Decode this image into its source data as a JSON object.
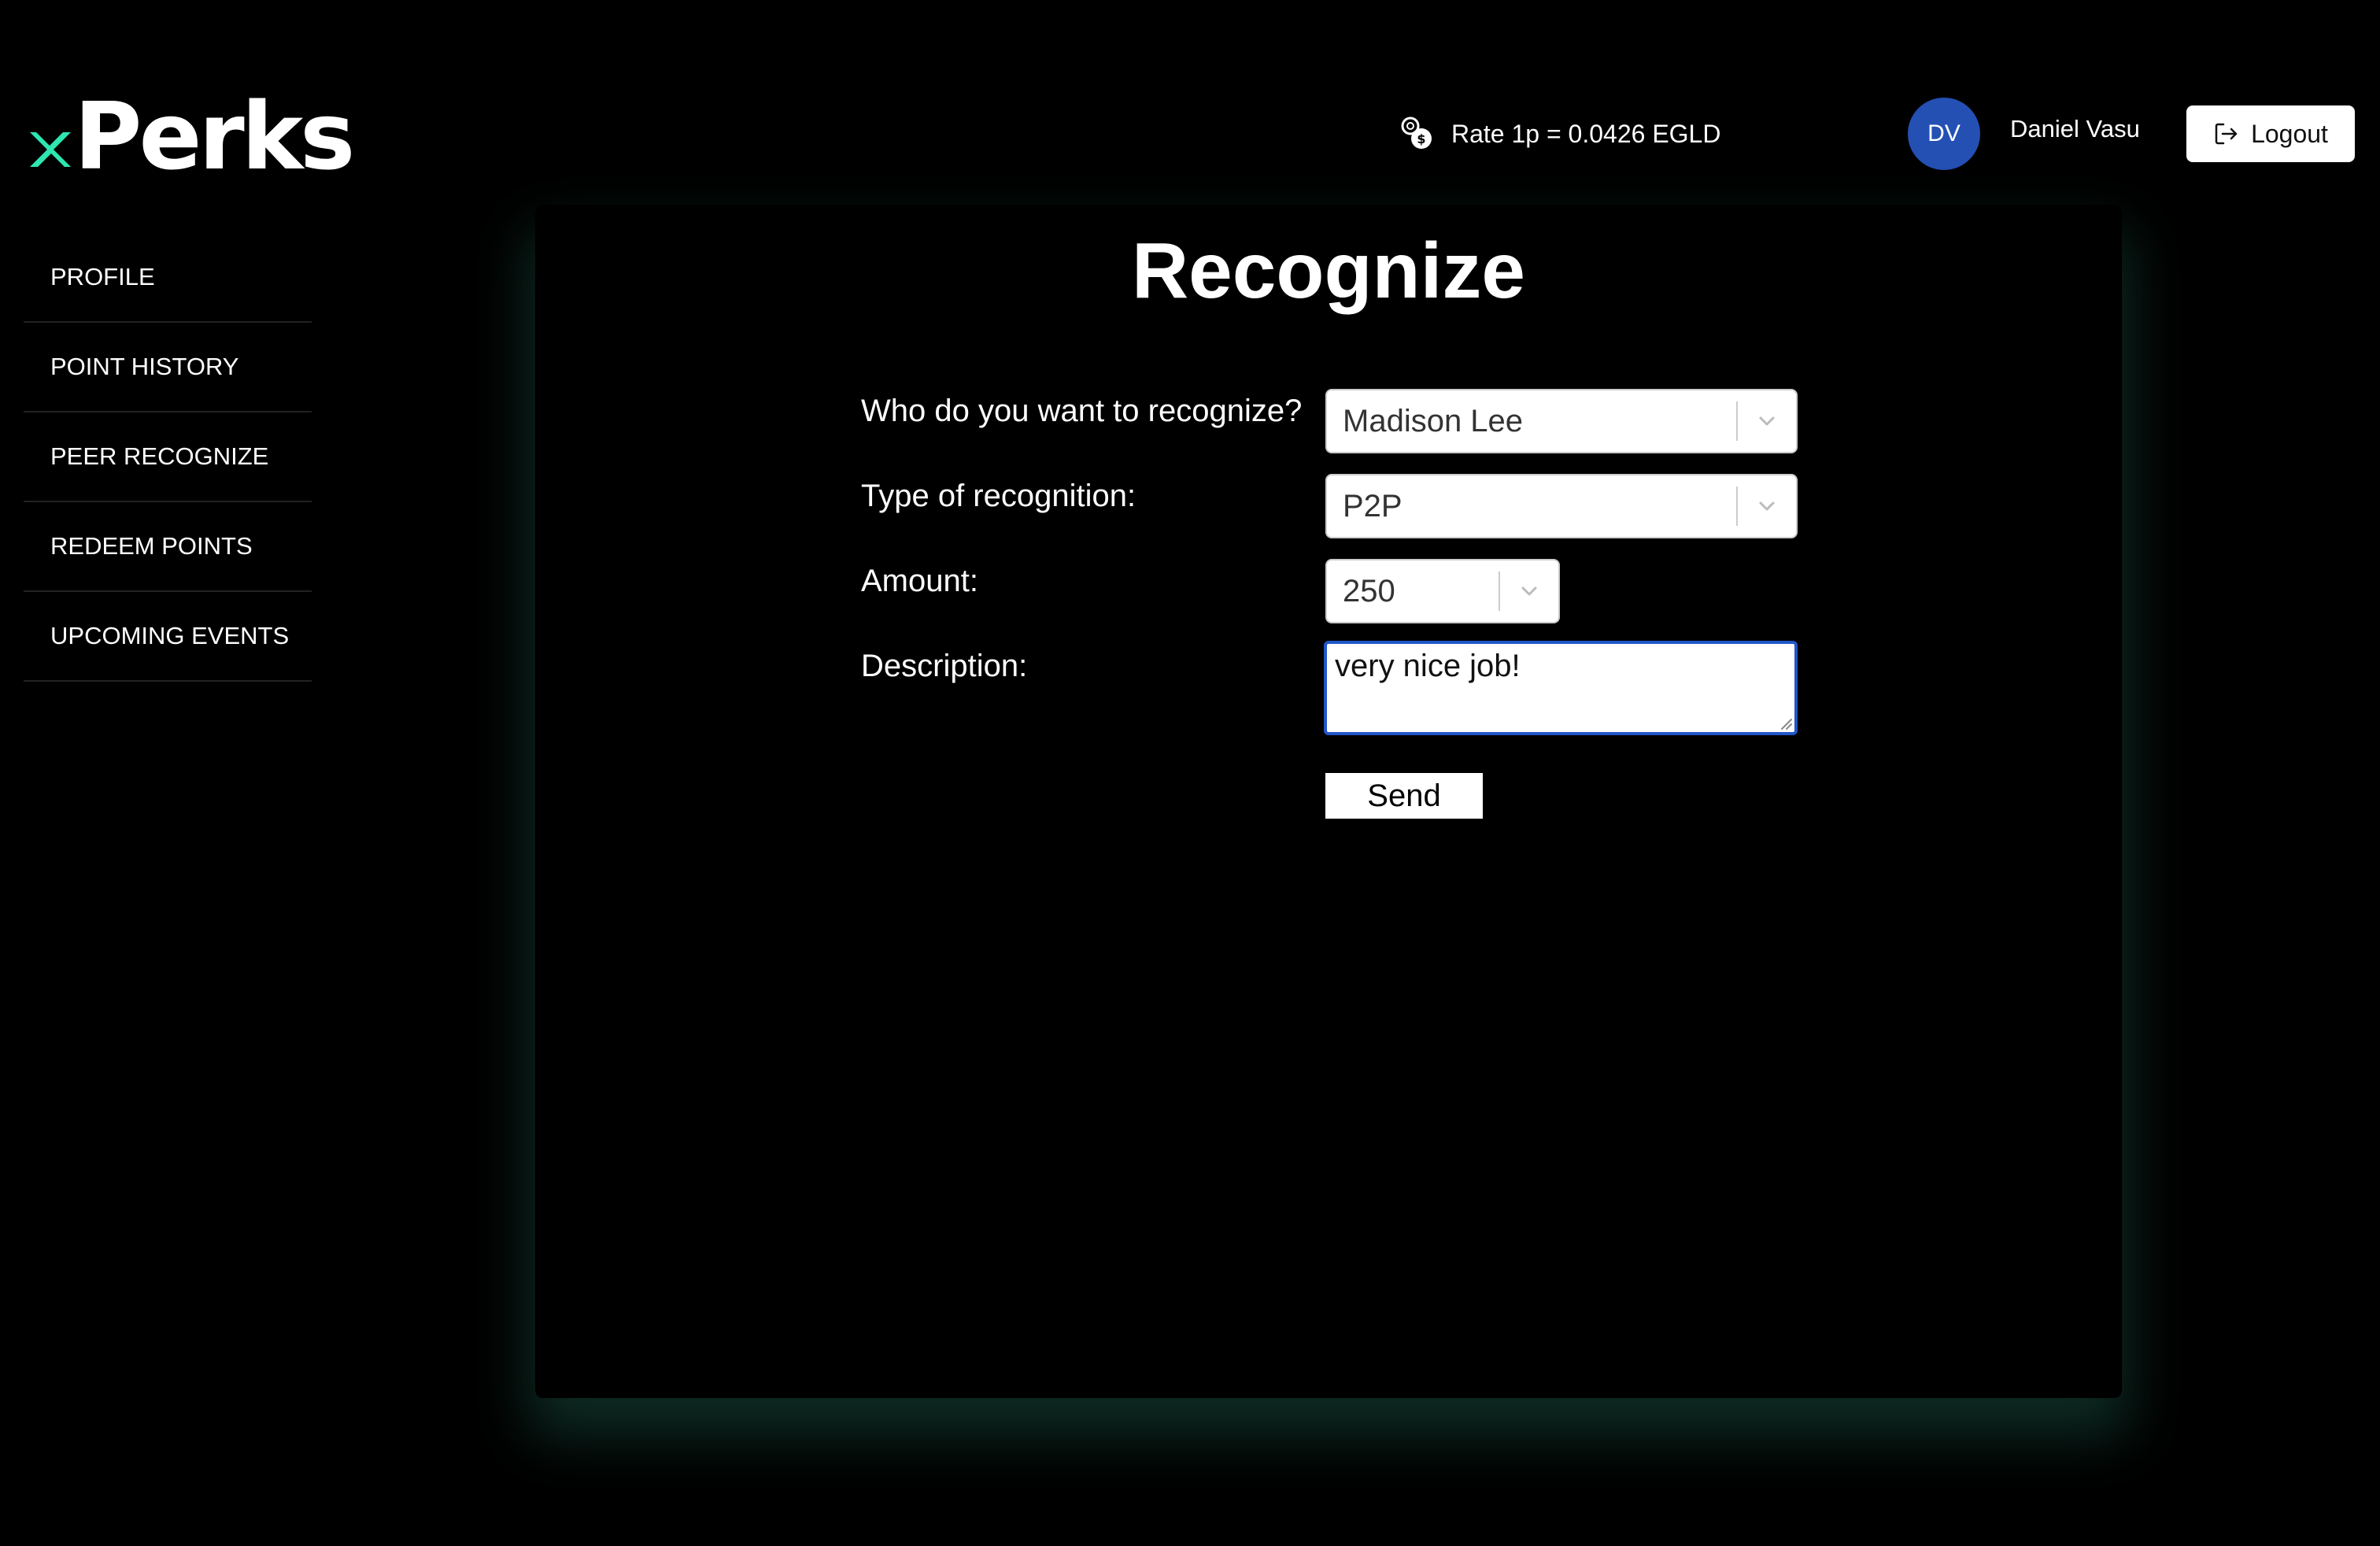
{
  "header": {
    "logo_text": "Perks",
    "rate_label": "Rate 1p = 0.0426 EGLD",
    "user_initials": "DV",
    "user_name": "Daniel Vasu",
    "logout_label": "Logout"
  },
  "sidebar": {
    "items": [
      {
        "label": "PROFILE"
      },
      {
        "label": "POINT HISTORY"
      },
      {
        "label": "PEER RECOGNIZE"
      },
      {
        "label": "REDEEM POINTS"
      },
      {
        "label": "UPCOMING EVENTS"
      }
    ]
  },
  "form": {
    "title": "Recognize",
    "recipient_label": "Who do you want to recognize?",
    "recipient_value": "Madison Lee",
    "type_label": "Type of recognition:",
    "type_value": "P2P",
    "amount_label": "Amount:",
    "amount_value": "250",
    "description_label": "Description:",
    "description_value": "very nice job!",
    "send_label": "Send"
  },
  "colors": {
    "logo_accent": "#2ee6b0",
    "avatar_bg": "#2450b4",
    "focus_border": "#2156c9",
    "card_glow": "#287864"
  }
}
